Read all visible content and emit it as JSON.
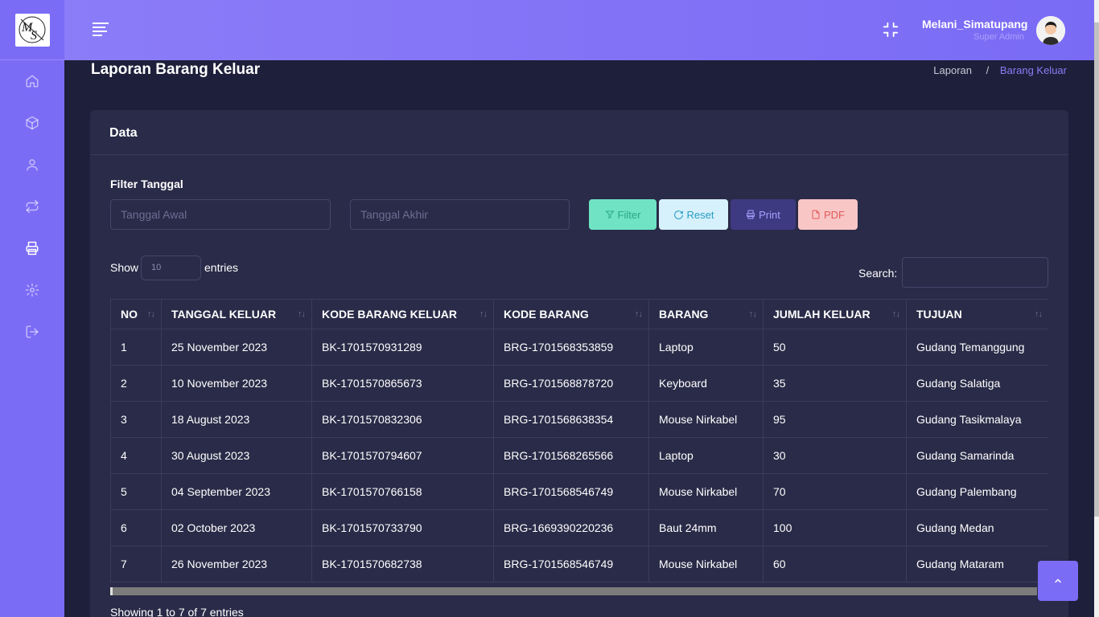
{
  "header": {
    "user_name": "Melani_Simatupang",
    "user_role": "Super Admin"
  },
  "sidebar": {
    "items": [
      {
        "icon": "home-icon"
      },
      {
        "icon": "box-icon"
      },
      {
        "icon": "user-icon"
      },
      {
        "icon": "transfer-icon"
      },
      {
        "icon": "printer-icon",
        "active": true
      },
      {
        "icon": "gear-icon"
      },
      {
        "icon": "logout-icon"
      }
    ]
  },
  "page": {
    "title": "Laporan Barang Keluar",
    "breadcrumb": [
      "Laporan",
      "Barang Keluar"
    ]
  },
  "card": {
    "title": "Data",
    "filter_label": "Filter Tanggal",
    "start_placeholder": "Tanggal Awal",
    "end_placeholder": "Tanggal Akhir",
    "buttons": {
      "filter": "Filter",
      "reset": "Reset",
      "print": "Print",
      "pdf": "PDF"
    },
    "show_label": "Show",
    "entries_label": "entries",
    "page_size": "10",
    "search_label": "Search:",
    "footer": "Showing 1 to 7 of 7 entries"
  },
  "table": {
    "columns": [
      "NO",
      "TANGGAL KELUAR",
      "KODE BARANG KELUAR",
      "KODE BARANG",
      "BARANG",
      "JUMLAH KELUAR",
      "TUJUAN"
    ],
    "rows": [
      [
        "1",
        "25 November 2023",
        "BK-1701570931289",
        "BRG-1701568353859",
        "Laptop",
        "50",
        "Gudang Temanggung"
      ],
      [
        "2",
        "10 November 2023",
        "BK-1701570865673",
        "BRG-1701568878720",
        "Keyboard",
        "35",
        "Gudang Salatiga"
      ],
      [
        "3",
        "18 August 2023",
        "BK-1701570832306",
        "BRG-1701568638354",
        "Mouse Nirkabel",
        "95",
        "Gudang Tasikmalaya"
      ],
      [
        "4",
        "30 August 2023",
        "BK-1701570794607",
        "BRG-1701568265566",
        "Laptop",
        "30",
        "Gudang Samarinda"
      ],
      [
        "5",
        "04 September 2023",
        "BK-1701570766158",
        "BRG-1701568546749",
        "Mouse Nirkabel",
        "70",
        "Gudang Palembang"
      ],
      [
        "6",
        "02 October 2023",
        "BK-1701570733790",
        "BRG-1669390220236",
        "Baut 24mm",
        "100",
        "Gudang Medan"
      ],
      [
        "7",
        "26 November 2023",
        "BK-1701570682738",
        "BRG-1701568546749",
        "Mouse Nirkabel",
        "60",
        "Gudang Mataram"
      ]
    ]
  }
}
